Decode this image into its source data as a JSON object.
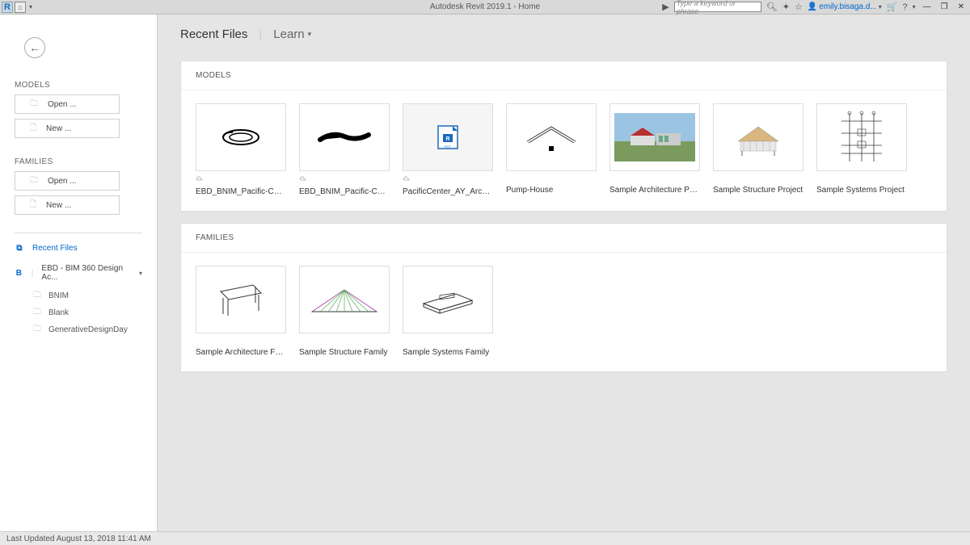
{
  "titlebar": {
    "title": "Autodesk Revit 2019.1 - Home",
    "search_placeholder": "Type a keyword or phrase",
    "user": "emily.bisaga.d...",
    "info_arrow": "▶"
  },
  "sidebar": {
    "models_label": "MODELS",
    "families_label": "FAMILIES",
    "open_label": "Open ...",
    "new_label": "New ...",
    "recent_files": "Recent Files",
    "bim_label": "EBD - BIM 360 Design Ac...",
    "b_prefix": "B",
    "tree": [
      "BNIM",
      "Blank",
      "GenerativeDesignDay"
    ]
  },
  "tabs": {
    "recent": "Recent Files",
    "learn": "Learn"
  },
  "panels": {
    "models_label": "MODELS",
    "families_label": "FAMILIES"
  },
  "models": [
    {
      "name": "EBD_BNIM_Pacific-Center",
      "cloud": true
    },
    {
      "name": "EBD_BNIM_Pacific-Center",
      "cloud": true
    },
    {
      "name": "PacificCenter_AY_Arch_deta...",
      "cloud": true
    },
    {
      "name": "Pump-House",
      "cloud": false
    },
    {
      "name": "Sample Architecture Project",
      "cloud": false
    },
    {
      "name": "Sample Structure Project",
      "cloud": false
    },
    {
      "name": "Sample Systems Project",
      "cloud": false
    }
  ],
  "families": [
    {
      "name": "Sample Architecture Family"
    },
    {
      "name": "Sample Structure Family"
    },
    {
      "name": "Sample Systems Family"
    }
  ],
  "statusbar": {
    "text": "Last Updated August 13, 2018 11:41 AM"
  }
}
